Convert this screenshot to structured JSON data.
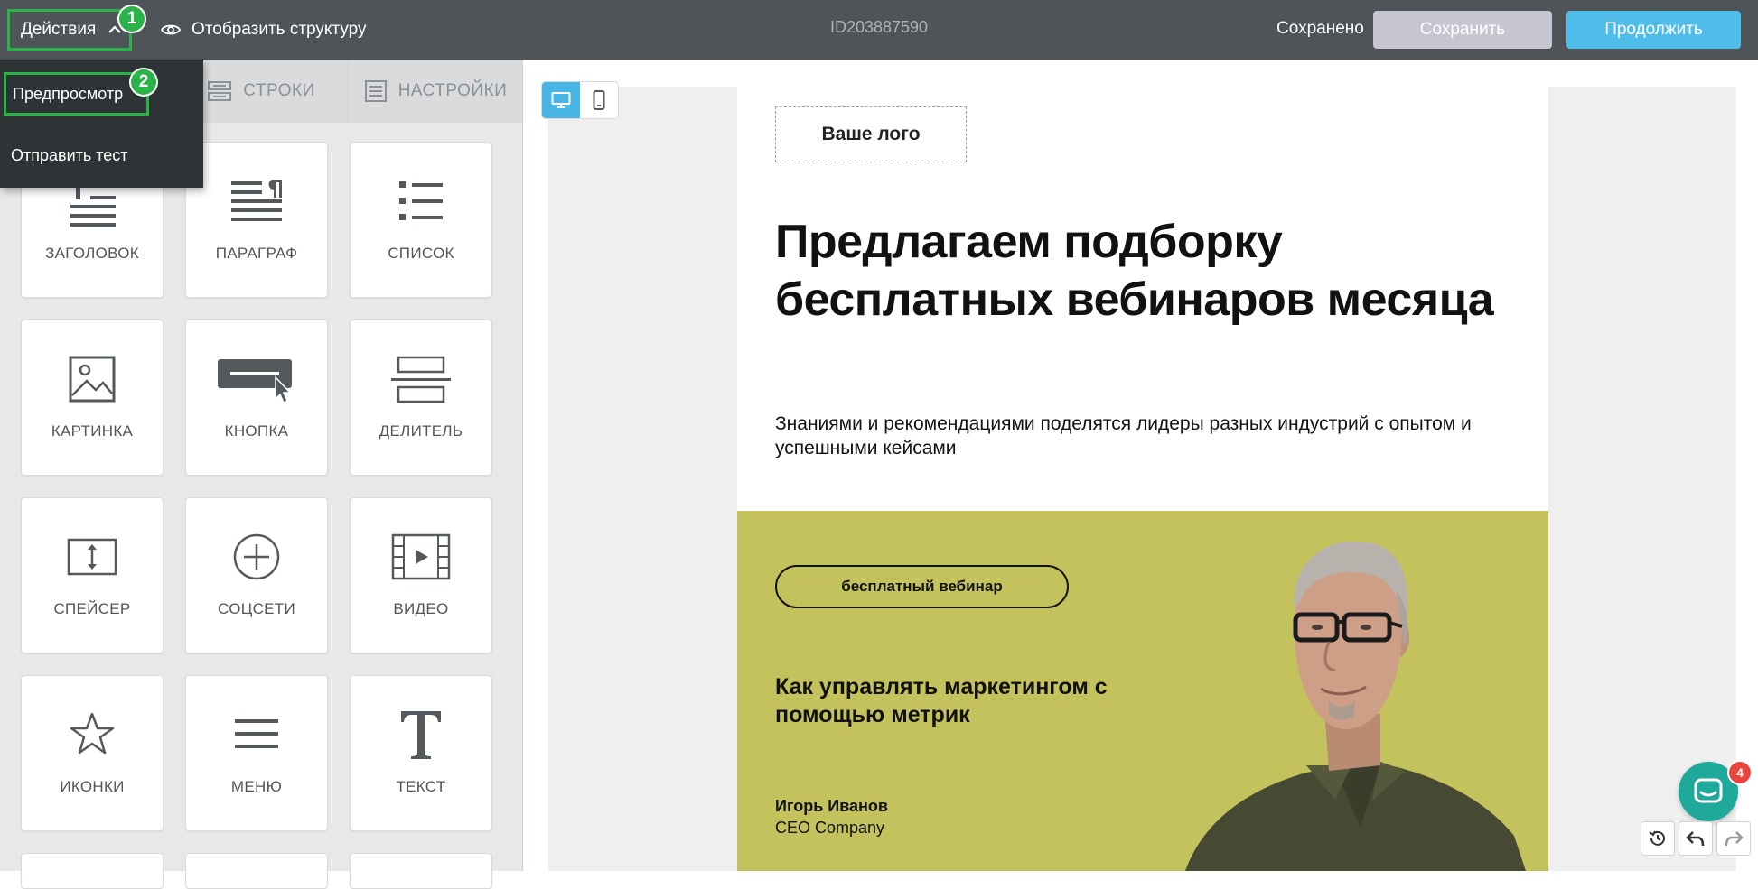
{
  "topbar": {
    "actions_label": "Действия",
    "show_structure_label": "Отобразить структуру",
    "document_id": "ID203887590",
    "saved_status": "Сохранено",
    "save_label": "Сохранить",
    "continue_label": "Продолжить"
  },
  "step_badges": [
    "1",
    "2"
  ],
  "actions_menu": {
    "preview_label": "Предпросмотр",
    "send_test_label": "Отправить тест"
  },
  "panel_tabs": [
    {
      "label": "СТРОКИ",
      "icon": "rows-icon"
    },
    {
      "label": "НАСТРОЙКИ",
      "icon": "settings-icon"
    }
  ],
  "tiles": [
    {
      "label": "ЗАГОЛОВОК",
      "icon": "heading-icon"
    },
    {
      "label": "ПАРАГРАФ",
      "icon": "paragraph-icon"
    },
    {
      "label": "СПИСОК",
      "icon": "list-icon"
    },
    {
      "label": "КАРТИНКА",
      "icon": "image-icon"
    },
    {
      "label": "КНОПКА",
      "icon": "button-icon"
    },
    {
      "label": "ДЕЛИТЕЛЬ",
      "icon": "divider-icon"
    },
    {
      "label": "СПЕЙСЕР",
      "icon": "spacer-icon"
    },
    {
      "label": "СОЦСЕТИ",
      "icon": "social-icon"
    },
    {
      "label": "ВИДЕО",
      "icon": "video-icon"
    },
    {
      "label": "ИКОНКИ",
      "icon": "star-icon"
    },
    {
      "label": "МЕНЮ",
      "icon": "menu-icon"
    },
    {
      "label": "ТЕКСТ",
      "icon": "text-icon"
    }
  ],
  "email": {
    "logo_text": "Ваше лого",
    "headline": "Предлагаем подборку бесплатных вебинаров месяца",
    "subtext": "Знаниями и рекомендациями поделятся лидеры разных индустрий с  опытом и успешными кейсами",
    "badge": "бесплатный вебинар",
    "webinar_title": "Как управлять маркетингом с помощью метрик",
    "speaker_name": "Игорь Иванов",
    "speaker_role": "CEO Company"
  },
  "chat": {
    "unread_count": "4"
  },
  "colors": {
    "topbar": "#4f5458",
    "accent_blue": "#4fbcea",
    "highlight_green": "#2bb34a",
    "promo_olive": "#c4c25d",
    "chat_teal": "#1fa99a"
  }
}
